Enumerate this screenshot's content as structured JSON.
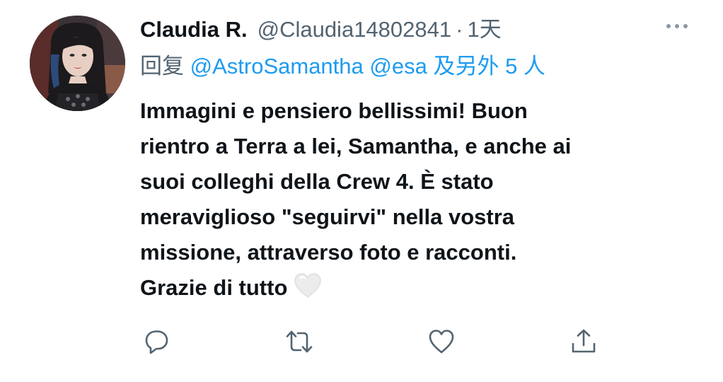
{
  "tweet": {
    "author_name": "Claudia R.",
    "author_handle": "@Claudia14802841",
    "separator": "·",
    "timestamp": "1天",
    "reply_prefix": "回复 ",
    "reply_mentions": [
      "@AstroSamantha",
      "@esa"
    ],
    "reply_others": "及另外 5 人",
    "body": "Immagini e pensiero bellissimi! Buon\nrientro a Terra a lei, Samantha, e anche ai\nsuoi colleghi della Crew 4.  È stato\nmeraviglioso \"seguirvi\" nella vostra\nmissione, attraverso foto e racconti.\nGrazie di tutto",
    "body_emoji": "white-heart-icon"
  },
  "actions": {
    "reply": "reply-icon",
    "retweet": "retweet-icon",
    "like": "like-icon",
    "share": "share-icon"
  },
  "colors": {
    "text_primary": "#0f1419",
    "text_secondary": "#536471",
    "accent": "#1d9bf0"
  }
}
